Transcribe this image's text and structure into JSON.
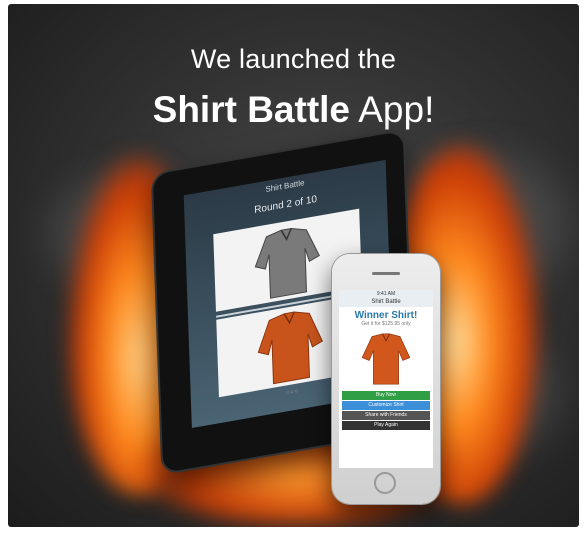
{
  "headline": {
    "line1": "We launched the",
    "line2_bold": "Shirt Battle",
    "line2_rest": " App!"
  },
  "tablet": {
    "app_title": "Shirt Battle",
    "round_label": "Round 2 of 10"
  },
  "phone": {
    "status_time": "9:41 AM",
    "app_title": "Shirt Battle",
    "winner_title": "Winner Shirt!",
    "winner_subtitle": "Get it for $125.95 only",
    "buttons": {
      "buy": "Buy Now",
      "customize": "Customize Shirt",
      "share": "Share with Friends",
      "play": "Play Again"
    }
  },
  "colors": {
    "background": "#2f2f2f",
    "fire": "#ff6a00",
    "buy_button": "#2f9e44",
    "customize_button": "#3a8fd8"
  }
}
